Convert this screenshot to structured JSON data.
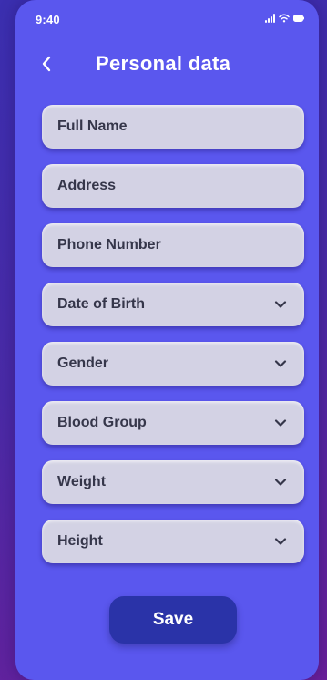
{
  "status_bar": {
    "time": "9:40"
  },
  "header": {
    "title": "Personal data",
    "back_icon": "chevron-left-icon"
  },
  "form": {
    "fields": [
      {
        "label": "Full Name",
        "type": "text"
      },
      {
        "label": "Address",
        "type": "text"
      },
      {
        "label": "Phone Number",
        "type": "text"
      },
      {
        "label": "Date of Birth",
        "type": "select"
      },
      {
        "label": "Gender",
        "type": "select"
      },
      {
        "label": "Blood Group",
        "type": "select"
      },
      {
        "label": "Weight",
        "type": "select"
      },
      {
        "label": "Height",
        "type": "select"
      }
    ]
  },
  "actions": {
    "save_label": "Save"
  },
  "colors": {
    "screen_background": "#5a57ee",
    "field_background": "#d3d2e4",
    "field_text": "#35364a",
    "save_button": "#2a33a8"
  }
}
